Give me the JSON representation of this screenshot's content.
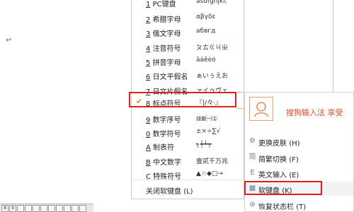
{
  "document": {
    "return_mark": "↵"
  },
  "keyboard_strip": {
    "keys": [
      "8",
      "9",
      "",
      "",
      "",
      "",
      "",
      "",
      "",
      "",
      "",
      ""
    ]
  },
  "menu": {
    "items": [
      {
        "num": "1",
        "label": "PC键盘",
        "sample": "asdfghjkl;",
        "checked": false
      },
      {
        "num": "2",
        "label": "希腊字母",
        "sample": "αβγδε",
        "checked": false
      },
      {
        "num": "3",
        "label": "俄文字母",
        "sample": "абвгд",
        "checked": false
      },
      {
        "num": "4",
        "label": "注音符号",
        "sample": "ㄆㄊㄍㄐㄓ",
        "checked": false
      },
      {
        "num": "5",
        "label": "拼音字母",
        "sample": "āáěèó",
        "checked": false
      },
      {
        "num": "6",
        "label": "日文平假名",
        "sample": "ぁいぅえお",
        "checked": false
      },
      {
        "num": "7",
        "label": "日文片假名",
        "sample": "ァイゥヴェ",
        "checked": false
      },
      {
        "num": "8",
        "label": "标点符号",
        "sample": "『|/々·』",
        "checked": true
      },
      {
        "num": "9",
        "label": "数字序号",
        "sample": "ⅠⅡⅢ㈠①",
        "checked": false
      },
      {
        "num": "0",
        "label": "数学符号",
        "sample": "±×÷∑√",
        "checked": false
      },
      {
        "num": "A",
        "label": "制表符",
        "sample": "┑┿┷┯",
        "checked": false
      },
      {
        "num": "B",
        "label": "中文数字",
        "sample": "壹贰千万兆",
        "checked": false
      },
      {
        "num": "C",
        "label": "特殊符号",
        "sample": "▲☆◆□→",
        "checked": false
      }
    ],
    "close_label": "关闭软键盘",
    "close_shortcut": "(L)"
  },
  "sogou_panel": {
    "brand_text": "搜狗输入法 享受",
    "items": [
      {
        "icon": "⚙",
        "icon_name": "skin-icon",
        "label": "更换皮肤",
        "shortcut": "(H)"
      },
      {
        "icon": "简",
        "icon_name": "simp-trad-icon",
        "label": "简繁切换",
        "shortcut": "(F)"
      },
      {
        "icon": "E",
        "icon_name": "english-input-icon",
        "label": "英文输入",
        "shortcut": "(E)"
      },
      {
        "icon": "▦",
        "icon_name": "soft-keyboard-icon",
        "label": "软键盘",
        "shortcut": "(K)"
      },
      {
        "icon": "⊛",
        "icon_name": "restore-statusbar-icon",
        "label": "恢复状态栏",
        "shortcut": "(T)"
      }
    ]
  },
  "colors": {
    "highlight": "#e02020",
    "brand": "#d74a2a",
    "check": "#e48a2c"
  }
}
